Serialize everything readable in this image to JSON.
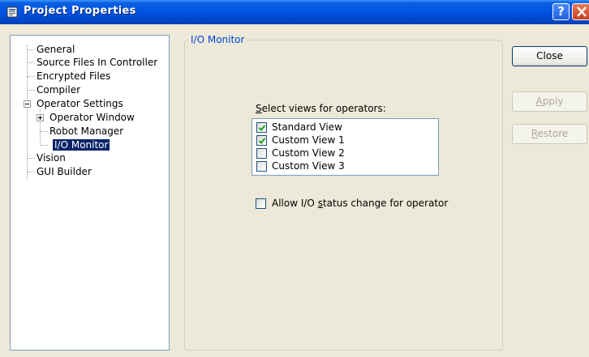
{
  "window": {
    "title": "Project Properties",
    "help_label": "?"
  },
  "tree": {
    "items": [
      {
        "label": "General"
      },
      {
        "label": "Source Files In Controller"
      },
      {
        "label": "Encrypted Files"
      },
      {
        "label": "Compiler"
      },
      {
        "label": "Operator Settings",
        "expanded": true
      },
      {
        "label": "Operator Window",
        "expanded": false
      },
      {
        "label": "Robot Manager"
      },
      {
        "label": "I/O Monitor",
        "selected": true
      },
      {
        "label": "Vision"
      },
      {
        "label": "GUI Builder"
      }
    ]
  },
  "panel": {
    "group_title": "I/O Monitor",
    "views_label_u": "S",
    "views_label_rest": "elect views for operators:",
    "views": [
      {
        "label": "Standard View",
        "checked": true
      },
      {
        "label": "Custom View 1",
        "checked": true
      },
      {
        "label": "Custom View 2",
        "checked": false
      },
      {
        "label": "Custom View 3",
        "checked": false
      }
    ],
    "allow_pre": "Allow I/O ",
    "allow_u": "s",
    "allow_post": "tatus change for operator",
    "allow_checked": false
  },
  "buttons": {
    "close": "Close",
    "apply_u": "A",
    "apply_rest": "pply",
    "restore_u": "R",
    "restore_rest": "estore"
  }
}
